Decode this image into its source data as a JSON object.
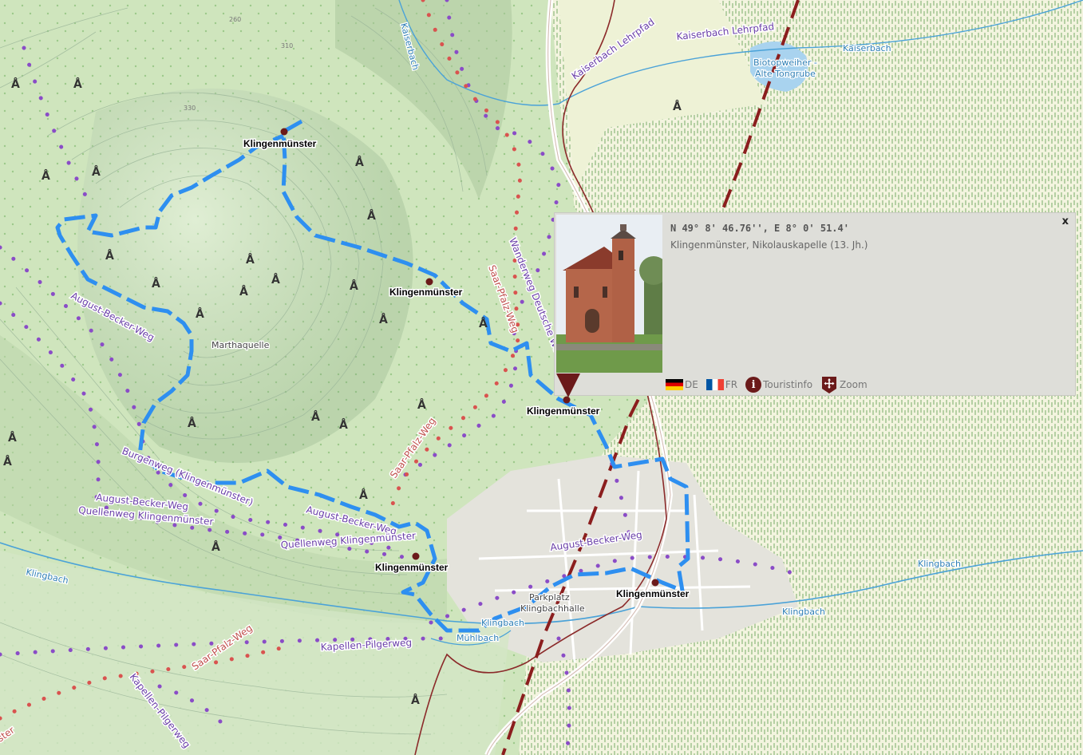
{
  "map": {
    "places": [
      {
        "name": "Klingenmünster"
      },
      {
        "name": "Klingenmünster"
      },
      {
        "name": "Klingenmünster"
      },
      {
        "name": "Klingenmünster"
      },
      {
        "name": "Klingenmünster"
      }
    ],
    "labels": {
      "marthaquelle": "Marthaquelle",
      "kaiserbach_top": "Kaiserbach",
      "kaiserbach_east": "Kaiserbach",
      "kaiserbach_lehrpfad": "Kaiserbach Lehrpfad",
      "kaiserbach_lehrpfad2": "Kaiserbach Lehrpfad",
      "biotopweiher_1": "Biotopweiher -",
      "biotopweiher_2": "Alte Tongrube",
      "august_becker_1": "August-Becker-Weg",
      "august_becker_2": "August-Becker-Weg",
      "august_becker_3": "August-Becker-Weg",
      "august_becker_4": "August-Becker-Weg",
      "burgenweg": "Burgenweg (Klingenmünster)",
      "quellenweg_1": "Quellenweg Klingenmünster",
      "quellenweg_2": "Quellenweg Klingenmünster",
      "saar_pfalz_1": "Saar-Pfalz-Weg",
      "saar_pfalz_2": "Saar-Pfalz-Weg",
      "saar_pfalz_3": "Saar-Pfalz-Weg",
      "wanderweg": "Wanderweg Deutsche Weinstraße",
      "kapellen_1": "Kapellen-Pilgerweg",
      "kapellen_2": "Kapellen-Pilgerweg",
      "klingbach_w": "Klingbach",
      "klingbach_c": "Klingbach",
      "klingbach_e1": "Klingbach",
      "klingbach_e2": "Klingbach",
      "muehlbach": "Mühlbach",
      "parkplatz": "Parkplatz",
      "klingbachhalle": "Klingbachhalle",
      "ster": "ster"
    },
    "contours": [
      "260",
      "310",
      "330"
    ]
  },
  "popup": {
    "coords": "N 49° 8' 46.76'', E 8° 0' 51.4'",
    "description": "Klingenmünster, Nikolauskapelle (13. Jh.)",
    "close_label": "x",
    "links": {
      "de": "DE",
      "fr": "FR",
      "touristinfo": "Touristinfo",
      "zoom": "Zoom"
    }
  },
  "colors": {
    "route": "#2e8ff0",
    "rail": "#7a1a1a",
    "trail_purple": "#8a4cc7",
    "trail_red": "#d9534f",
    "water": "#67b7e6",
    "forest": "#d4e7c4",
    "vineyard": "#f2f2de",
    "town": "#e6e4dc",
    "marker": "#6b1a1a"
  }
}
